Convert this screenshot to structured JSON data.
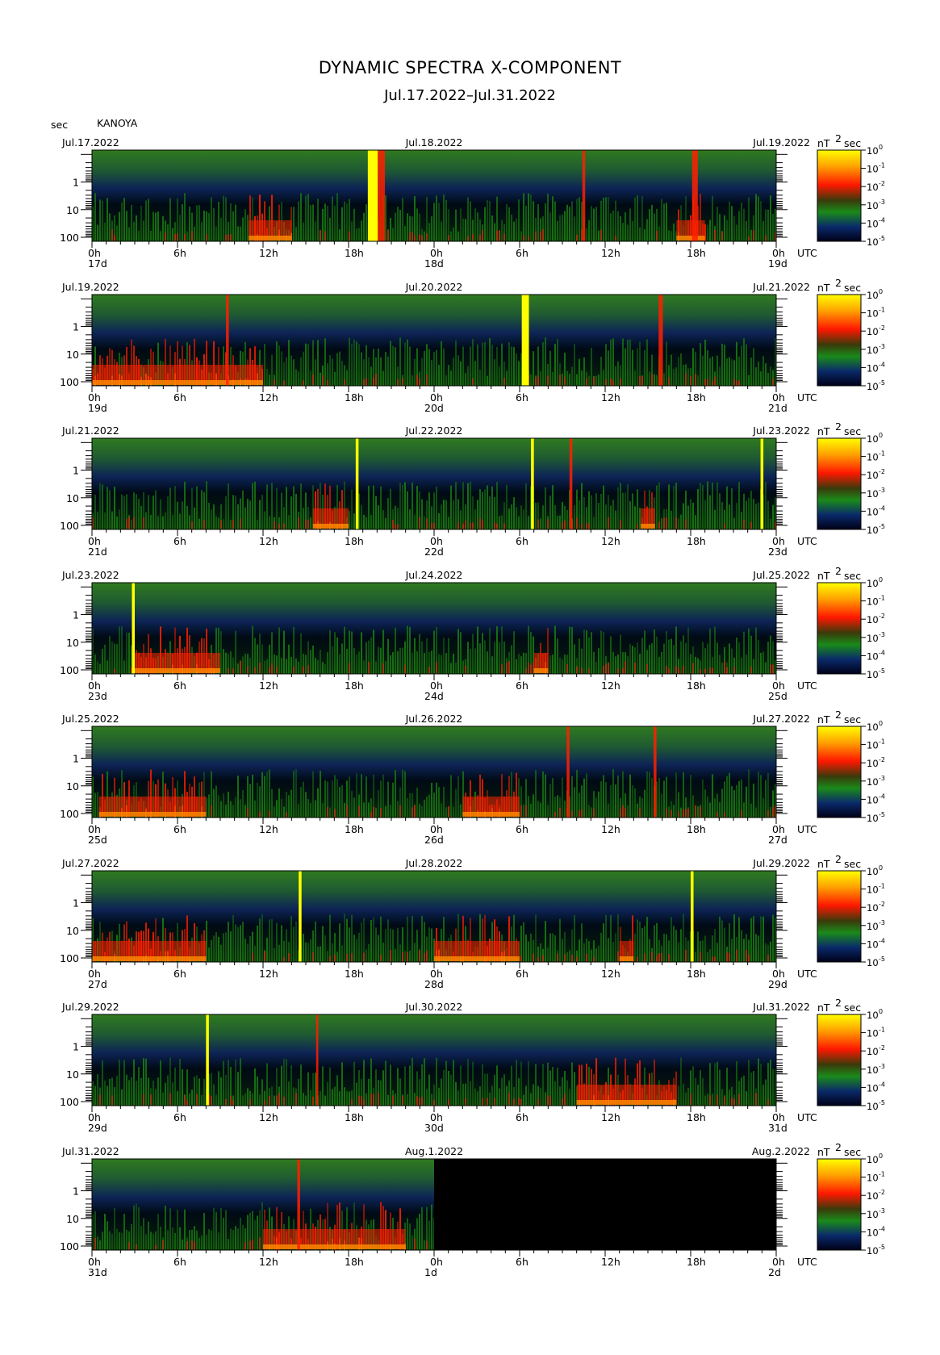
{
  "title": "DYNAMIC SPECTRA X-COMPONENT",
  "subtitle": "Jul.17.2022–Jul.31.2022",
  "y_unit": "sec",
  "station": "KANOYA",
  "colorbar_unit": "nT",
  "colorbar_unit_exp": "2",
  "colorbar_unit_suffix": "sec",
  "utc_label": "UTC",
  "colors": {
    "low": "#000033",
    "mid_low": "#0b2a5a",
    "mid": "#1a7a12",
    "high": "#ff2000",
    "max": "#ffff00"
  },
  "chart_data": {
    "type": "heatmap",
    "y_axis": {
      "label": "sec",
      "scale": "log",
      "ticks": [
        "1",
        "10",
        "100"
      ]
    },
    "x_ticks": [
      "0h",
      "6h",
      "12h",
      "18h",
      "0h",
      "6h",
      "12h",
      "18h",
      "0h"
    ],
    "colorbar_ticks": [
      {
        "base": "10",
        "exp": "0"
      },
      {
        "base": "10",
        "exp": "-1"
      },
      {
        "base": "10",
        "exp": "-2"
      },
      {
        "base": "10",
        "exp": "-3"
      },
      {
        "base": "10",
        "exp": "-4"
      },
      {
        "base": "10",
        "exp": "-5"
      }
    ],
    "panels": [
      {
        "date_left": "Jul.17.2022",
        "date_mid": "Jul.18.2022",
        "date_right": "Jul.19.2022",
        "day_left": "17d",
        "day_mid": "18d",
        "day_right": "19d",
        "spikes": [
          {
            "hour": 19.7,
            "level": "max",
            "width_h": 0.7
          },
          {
            "hour": 20.3,
            "level": "high",
            "width_h": 0.5
          },
          {
            "hour": 34.5,
            "level": "high",
            "width_h": 0.2
          },
          {
            "hour": 42.3,
            "level": "high",
            "width_h": 0.4
          }
        ],
        "red_bursts": [
          {
            "start_h": 11,
            "end_h": 14
          },
          {
            "start_h": 41,
            "end_h": 43
          }
        ],
        "no_data_from_h": null
      },
      {
        "date_left": "Jul.19.2022",
        "date_mid": "Jul.20.2022",
        "date_right": "Jul.21.2022",
        "day_left": "19d",
        "day_mid": "20d",
        "day_right": "21d",
        "spikes": [
          {
            "hour": 30.4,
            "level": "max",
            "width_h": 0.5
          },
          {
            "hour": 39.9,
            "level": "high",
            "width_h": 0.3
          },
          {
            "hour": 9.5,
            "level": "high",
            "width_h": 0.2
          }
        ],
        "red_bursts": [
          {
            "start_h": 0,
            "end_h": 12
          }
        ],
        "no_data_from_h": null
      },
      {
        "date_left": "Jul.21.2022",
        "date_mid": "Jul.22.2022",
        "date_right": "Jul.23.2022",
        "day_left": "21d",
        "day_mid": "22d",
        "day_right": "23d",
        "spikes": [
          {
            "hour": 18.6,
            "level": "max",
            "width_h": 0.2
          },
          {
            "hour": 30.9,
            "level": "max",
            "width_h": 0.2
          },
          {
            "hour": 33.6,
            "level": "high",
            "width_h": 0.2
          },
          {
            "hour": 47.0,
            "level": "max",
            "width_h": 0.2
          }
        ],
        "red_bursts": [
          {
            "start_h": 15.5,
            "end_h": 18
          },
          {
            "start_h": 38.5,
            "end_h": 39.5
          }
        ],
        "no_data_from_h": null
      },
      {
        "date_left": "Jul.23.2022",
        "date_mid": "Jul.24.2022",
        "date_right": "Jul.25.2022",
        "day_left": "23d",
        "day_mid": "24d",
        "day_right": "25d",
        "spikes": [
          {
            "hour": 2.9,
            "level": "max",
            "width_h": 0.2
          }
        ],
        "red_bursts": [
          {
            "start_h": 2.8,
            "end_h": 9
          },
          {
            "start_h": 31,
            "end_h": 32
          }
        ],
        "no_data_from_h": null
      },
      {
        "date_left": "Jul.25.2022",
        "date_mid": "Jul.26.2022",
        "date_right": "Jul.27.2022",
        "day_left": "25d",
        "day_mid": "26d",
        "day_right": "27d",
        "spikes": [
          {
            "hour": 33.4,
            "level": "high",
            "width_h": 0.2
          },
          {
            "hour": 39.5,
            "level": "high",
            "width_h": 0.2
          }
        ],
        "red_bursts": [
          {
            "start_h": 0.5,
            "end_h": 8
          },
          {
            "start_h": 26,
            "end_h": 30
          }
        ],
        "no_data_from_h": null
      },
      {
        "date_left": "Jul.27.2022",
        "date_mid": "Jul.28.2022",
        "date_right": "Jul.29.2022",
        "day_left": "27d",
        "day_mid": "28d",
        "day_right": "29d",
        "spikes": [
          {
            "hour": 14.6,
            "level": "max",
            "width_h": 0.2
          },
          {
            "hour": 42.1,
            "level": "max",
            "width_h": 0.2
          }
        ],
        "red_bursts": [
          {
            "start_h": 0,
            "end_h": 8
          },
          {
            "start_h": 24,
            "end_h": 30
          },
          {
            "start_h": 37,
            "end_h": 38
          }
        ],
        "no_data_from_h": null
      },
      {
        "date_left": "Jul.29.2022",
        "date_mid": "Jul.30.2022",
        "date_right": "Jul.31.2022",
        "day_left": "29d",
        "day_mid": "30d",
        "day_right": "31d",
        "spikes": [
          {
            "hour": 8.1,
            "level": "max",
            "width_h": 0.2
          },
          {
            "hour": 15.8,
            "level": "high",
            "width_h": 0.15
          }
        ],
        "red_bursts": [
          {
            "start_h": 34,
            "end_h": 41
          }
        ],
        "no_data_from_h": null
      },
      {
        "date_left": "Jul.31.2022",
        "date_mid": "Aug.1.2022",
        "date_right": "Aug.2.2022",
        "day_left": "31d",
        "day_mid": "1d",
        "day_right": "2d",
        "spikes": [
          {
            "hour": 14.5,
            "level": "high",
            "width_h": 0.2
          }
        ],
        "red_bursts": [
          {
            "start_h": 12,
            "end_h": 22
          }
        ],
        "no_data_from_h": 24
      }
    ]
  }
}
